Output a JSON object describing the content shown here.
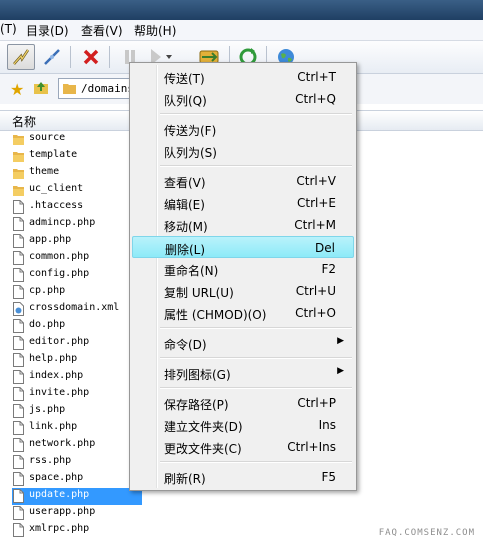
{
  "menubar": {
    "items": [
      "(T)",
      "目录(D)",
      "查看(V)",
      "帮助(H)"
    ]
  },
  "toolbar": {
    "buttons": [
      "connect-icon",
      "disconnect-icon",
      "cancel-icon",
      "pause-icon",
      "play-icon",
      "transfer-icon",
      "refresh-icon",
      "globe-icon"
    ]
  },
  "address": {
    "path": "/domains"
  },
  "filelist": {
    "column_name": "名称",
    "items": [
      {
        "name": "source",
        "type": "folder"
      },
      {
        "name": "template",
        "type": "folder"
      },
      {
        "name": "theme",
        "type": "folder"
      },
      {
        "name": "uc_client",
        "type": "folder"
      },
      {
        "name": ".htaccess",
        "type": "file"
      },
      {
        "name": "admincp.php",
        "type": "file"
      },
      {
        "name": "app.php",
        "type": "file"
      },
      {
        "name": "common.php",
        "type": "file"
      },
      {
        "name": "config.php",
        "type": "file"
      },
      {
        "name": "cp.php",
        "type": "file"
      },
      {
        "name": "crossdomain.xml",
        "type": "xml"
      },
      {
        "name": "do.php",
        "type": "file"
      },
      {
        "name": "editor.php",
        "type": "file"
      },
      {
        "name": "help.php",
        "type": "file"
      },
      {
        "name": "index.php",
        "type": "file"
      },
      {
        "name": "invite.php",
        "type": "file"
      },
      {
        "name": "js.php",
        "type": "file"
      },
      {
        "name": "link.php",
        "type": "file"
      },
      {
        "name": "network.php",
        "type": "file"
      },
      {
        "name": "rss.php",
        "type": "file"
      },
      {
        "name": "space.php",
        "type": "file"
      },
      {
        "name": "update.php",
        "type": "file",
        "selected": true
      },
      {
        "name": "userapp.php",
        "type": "file"
      },
      {
        "name": "xmlrpc.php",
        "type": "file"
      }
    ]
  },
  "context_menu": {
    "items": [
      {
        "label": "传送(T)",
        "shortcut": "Ctrl+T"
      },
      {
        "label": "队列(Q)",
        "shortcut": "Ctrl+Q"
      },
      {
        "sep": true
      },
      {
        "label": "传送为(F)",
        "shortcut": ""
      },
      {
        "label": "队列为(S)",
        "shortcut": ""
      },
      {
        "sep": true
      },
      {
        "label": "查看(V)",
        "shortcut": "Ctrl+V"
      },
      {
        "label": "编辑(E)",
        "shortcut": "Ctrl+E"
      },
      {
        "label": "移动(M)",
        "shortcut": "Ctrl+M"
      },
      {
        "label": "删除(L)",
        "shortcut": "Del",
        "highlighted": true
      },
      {
        "label": "重命名(N)",
        "shortcut": "F2"
      },
      {
        "label": "复制 URL(U)",
        "shortcut": "Ctrl+U"
      },
      {
        "label": "属性 (CHMOD)(O)",
        "shortcut": "Ctrl+O"
      },
      {
        "sep": true
      },
      {
        "label": "命令(D)",
        "shortcut": "",
        "submenu": true
      },
      {
        "sep": true
      },
      {
        "label": "排列图标(G)",
        "shortcut": "",
        "submenu": true
      },
      {
        "sep": true
      },
      {
        "label": "保存路径(P)",
        "shortcut": "Ctrl+P"
      },
      {
        "label": "建立文件夹(D)",
        "shortcut": "Ins"
      },
      {
        "label": "更改文件夹(C)",
        "shortcut": "Ctrl+Ins"
      },
      {
        "sep": true
      },
      {
        "label": "刷新(R)",
        "shortcut": "F5"
      }
    ]
  },
  "watermark": "FAQ.COMSENZ.COM",
  "colors": {
    "selection": "#3399ff",
    "menu_highlight": "#8deaf8",
    "folder": "#e8b64a"
  }
}
